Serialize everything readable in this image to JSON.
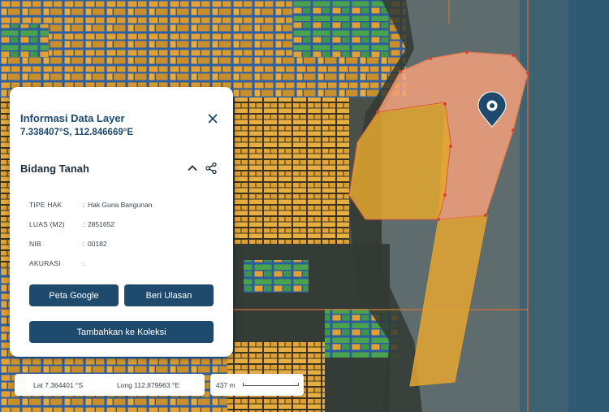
{
  "info_panel": {
    "title": "Informasi Data Layer",
    "coordinates": "7.338407°S, 112.846669°E",
    "section_title": "Bidang Tanah",
    "attributes": [
      {
        "key": "TIPE HAK",
        "value": "Hak Guna Bangunan"
      },
      {
        "key": "LUAS (M2)",
        "value": "2851652"
      },
      {
        "key": "NIB",
        "value": "00182"
      },
      {
        "key": "AKURASI",
        "value": ""
      }
    ],
    "buttons": {
      "google_maps": "Peta Google",
      "review": "Beri Ulasan",
      "add_collection": "Tambahkan ke Koleksi"
    }
  },
  "status_bar": {
    "lat": "Lat 7.364401 °S",
    "long": "Long 112.879963 °E",
    "scale": "437 m"
  },
  "colors": {
    "brand": "#1e4a6d",
    "parcel_hgb": "#e8a631",
    "parcel_other": "#2f6fc0",
    "parcel_green": "#4aa54a",
    "selected_parcel": "#f2a07a",
    "marker": "#1e4a6d"
  },
  "icons": [
    "close-icon",
    "chevron-up-icon",
    "share-icon",
    "location-pin-icon"
  ]
}
